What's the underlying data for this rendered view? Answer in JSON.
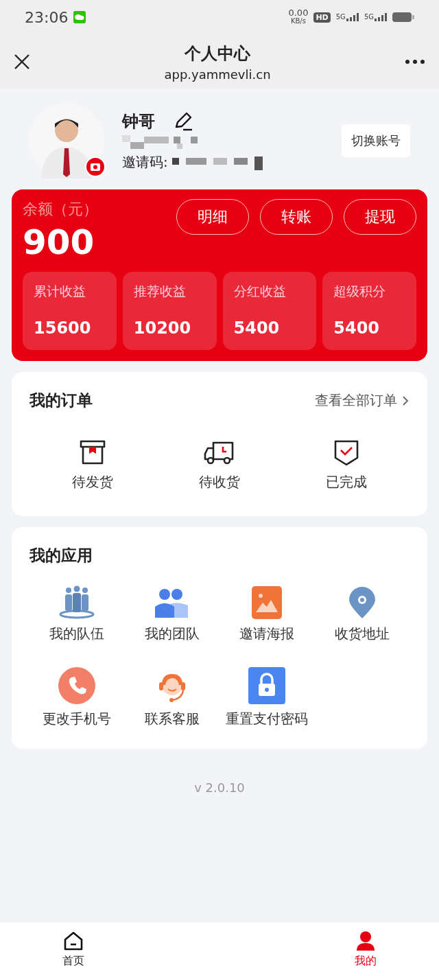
{
  "status_bar": {
    "time": "23:06",
    "speed": "0.00",
    "speed_unit": "KB/s",
    "hd": "HD",
    "networks": [
      "5G",
      "5G"
    ]
  },
  "header": {
    "title": "个人中心",
    "url": "app.yammevli.cn"
  },
  "profile": {
    "name": "钟哥",
    "invite_label": "邀请码:",
    "switch_button": "切换账号"
  },
  "balance": {
    "label": "余额（元）",
    "amount": "900",
    "actions": [
      "明细",
      "转账",
      "提现"
    ],
    "stats": [
      {
        "label": "累计收益",
        "value": "15600"
      },
      {
        "label": "推荐收益",
        "value": "10200"
      },
      {
        "label": "分红收益",
        "value": "5400"
      },
      {
        "label": "超级积分",
        "value": "5400"
      }
    ]
  },
  "orders": {
    "title": "我的订单",
    "link": "查看全部订单",
    "items": [
      {
        "kind": "box",
        "label": "待发货"
      },
      {
        "kind": "truck",
        "label": "待收货"
      },
      {
        "kind": "check",
        "label": "已完成"
      }
    ]
  },
  "apps": {
    "title": "我的应用",
    "items": [
      {
        "kind": "crowd",
        "label": "我的队伍"
      },
      {
        "kind": "team",
        "label": "我的团队"
      },
      {
        "kind": "poster",
        "label": "邀请海报"
      },
      {
        "kind": "pin",
        "label": "收货地址"
      },
      {
        "kind": "phone",
        "label": "更改手机号"
      },
      {
        "kind": "service",
        "label": "联系客服"
      },
      {
        "kind": "lock",
        "label": "重置支付密码"
      }
    ]
  },
  "version": "v 2.0.10",
  "tabbar": [
    {
      "kind": "home",
      "label": "首页",
      "selected": false
    },
    {
      "kind": "user",
      "label": "我的",
      "selected": true
    }
  ]
}
